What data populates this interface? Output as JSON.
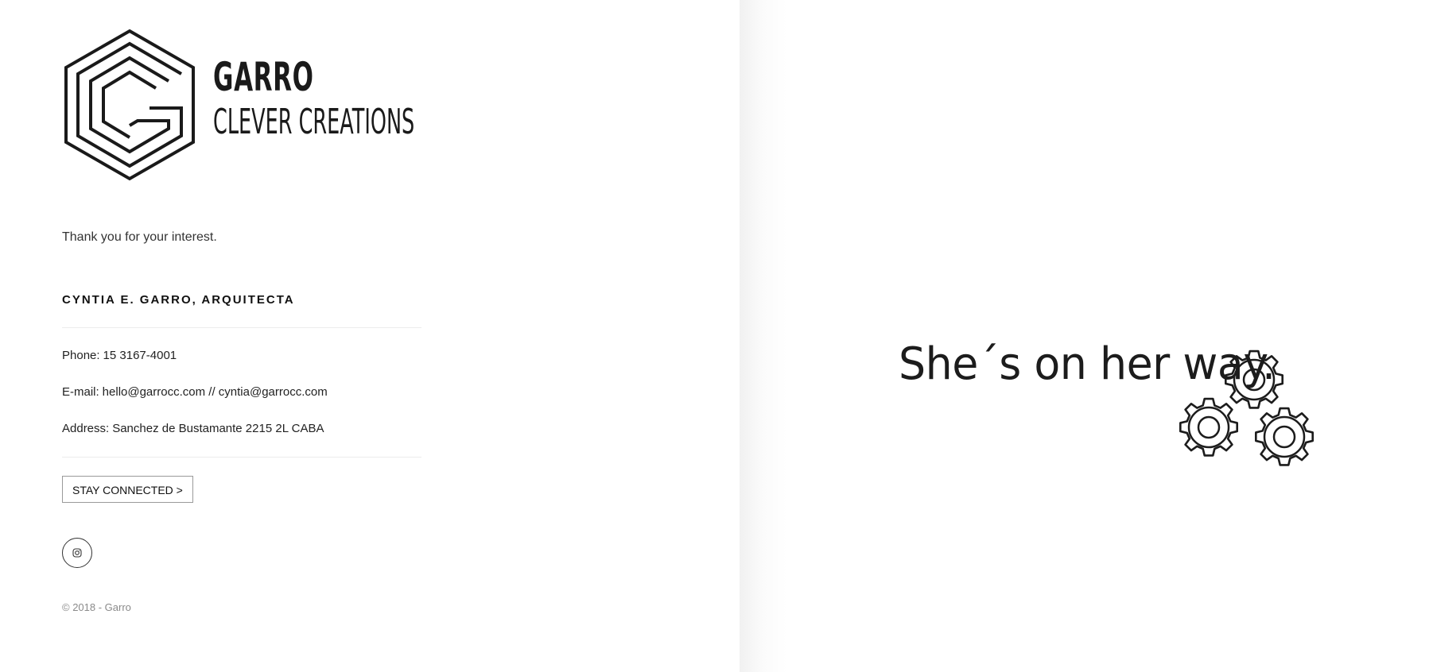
{
  "logo": {
    "brand": "GARRO",
    "tagline": "CLEVER CREATIONS",
    "icon": "hexagon-g-logo"
  },
  "intro": {
    "thanks": "Thank you for your interest."
  },
  "contact": {
    "heading": "CYNTIA E. GARRO, ARQUITECTA",
    "phone_label": "Phone:",
    "phone_value": "15 3167-4001",
    "email_label": "E-mail:",
    "email_value": "hello@garrocc.com // cyntia@garrocc.com",
    "address_label": "Address:",
    "address_value": "Sanchez de Bustamante 2215 2L CABA"
  },
  "actions": {
    "stay_connected_label": "STAY CONNECTED >",
    "social_icon": "instagram-icon"
  },
  "footer": {
    "copyright": "© 2018 - Garro"
  },
  "hero": {
    "message": "She´s on her way.",
    "decoration": "gears-icon"
  },
  "colors": {
    "text": "#111111",
    "muted": "#8a8a8a",
    "divider": "#ececec",
    "right_panel_shadow": "#f1f1f1"
  }
}
